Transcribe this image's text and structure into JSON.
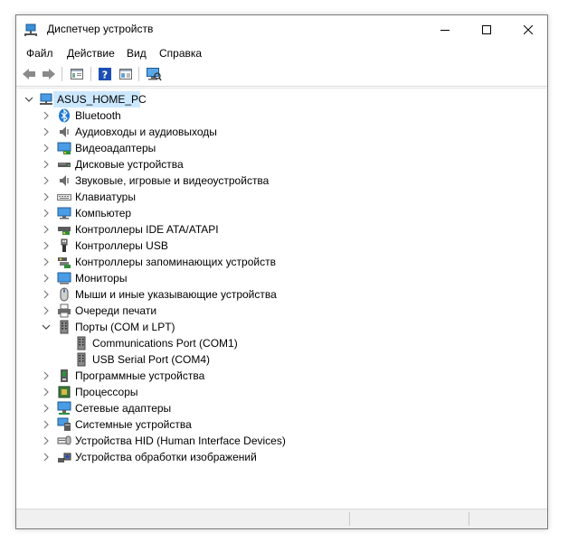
{
  "window": {
    "title": "Диспетчер устройств",
    "minimize_icon": "minimize-icon",
    "maximize_icon": "maximize-icon",
    "close_icon": "close-icon"
  },
  "menu": [
    "Файл",
    "Действие",
    "Вид",
    "Справка"
  ],
  "toolbar": [
    "back-arrow-icon",
    "forward-arrow-icon",
    "properties-icon",
    "help-icon",
    "action-view-icon",
    "monitor-scan-icon"
  ],
  "tree": {
    "root": "ASUS_HOME_PC",
    "categories": [
      {
        "label": "Bluetooth",
        "icon": "bluetooth-icon"
      },
      {
        "label": "Аудиовходы и аудиовыходы",
        "icon": "speaker-icon"
      },
      {
        "label": "Видеоадаптеры",
        "icon": "display-adapter-icon"
      },
      {
        "label": "Дисковые устройства",
        "icon": "disk-drive-icon"
      },
      {
        "label": "Звуковые, игровые и видеоустройства",
        "icon": "speaker-icon"
      },
      {
        "label": "Клавиатуры",
        "icon": "keyboard-icon"
      },
      {
        "label": "Компьютер",
        "icon": "computer-icon"
      },
      {
        "label": "Контроллеры IDE ATA/ATAPI",
        "icon": "ide-controller-icon"
      },
      {
        "label": "Контроллеры USB",
        "icon": "usb-icon"
      },
      {
        "label": "Контроллеры запоминающих устройств",
        "icon": "storage-controller-icon"
      },
      {
        "label": "Мониторы",
        "icon": "monitor-icon"
      },
      {
        "label": "Мыши и иные указывающие устройства",
        "icon": "mouse-icon"
      },
      {
        "label": "Очереди печати",
        "icon": "printer-icon"
      },
      {
        "label": "Порты (COM и LPT)",
        "icon": "port-icon",
        "expanded": true,
        "children": [
          {
            "label": "Communications Port (COM1)",
            "icon": "port-icon"
          },
          {
            "label": "USB Serial Port (COM4)",
            "icon": "port-icon"
          }
        ]
      },
      {
        "label": "Программные устройства",
        "icon": "software-device-icon"
      },
      {
        "label": "Процессоры",
        "icon": "processor-icon"
      },
      {
        "label": "Сетевые адаптеры",
        "icon": "network-adapter-icon"
      },
      {
        "label": "Системные устройства",
        "icon": "system-device-icon"
      },
      {
        "label": "Устройства HID (Human Interface Devices)",
        "icon": "hid-icon"
      },
      {
        "label": "Устройства обработки изображений",
        "icon": "camera-icon"
      }
    ]
  },
  "colors": {
    "selection": "#cce8ff",
    "accent_blue": "#1e78d7",
    "chevron": "#7a7a7a"
  }
}
